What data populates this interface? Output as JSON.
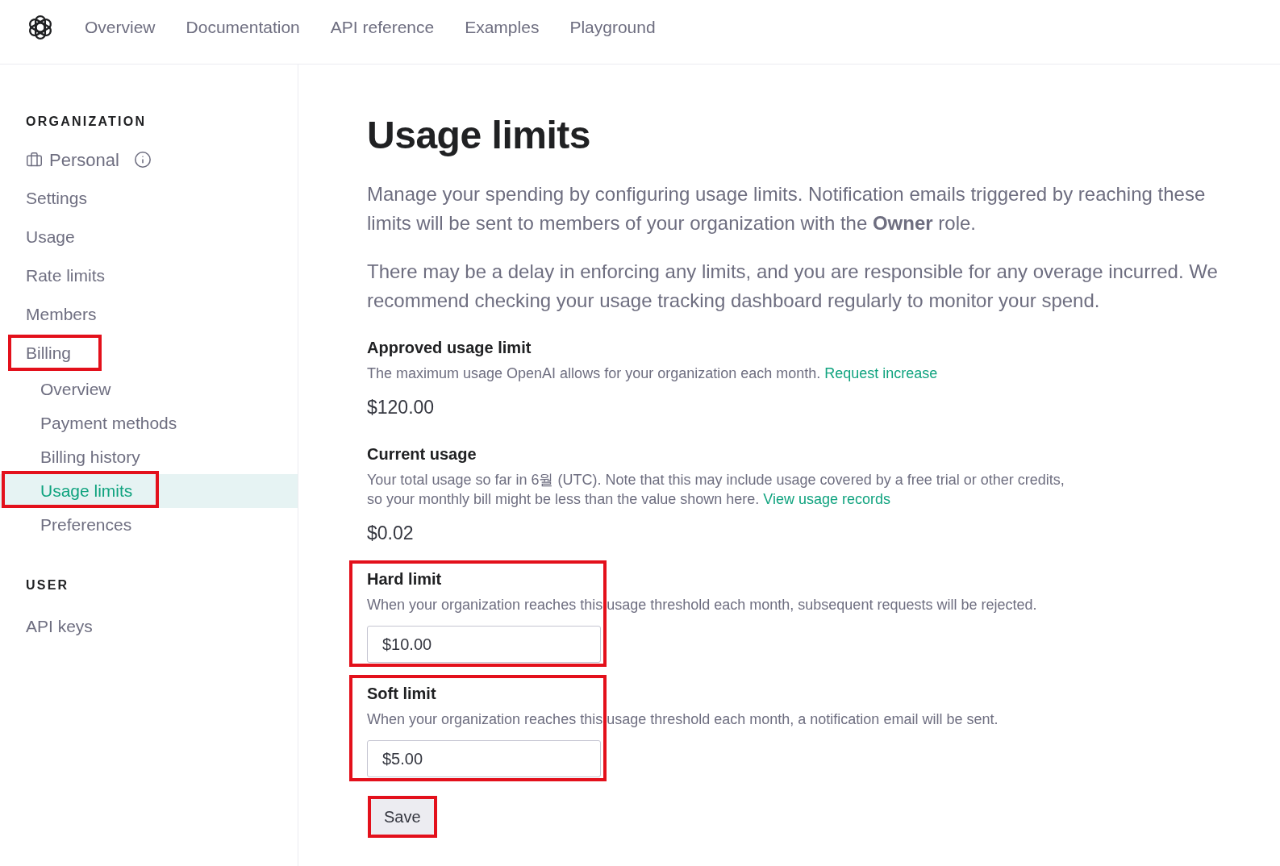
{
  "nav": {
    "items": [
      {
        "label": "Overview"
      },
      {
        "label": "Documentation"
      },
      {
        "label": "API reference"
      },
      {
        "label": "Examples"
      },
      {
        "label": "Playground"
      }
    ]
  },
  "sidebar": {
    "sections": [
      {
        "heading": "ORGANIZATION",
        "items": [
          {
            "label": "Personal",
            "kind": "organization",
            "selected": false,
            "highlighted": false
          },
          {
            "label": "Settings",
            "kind": "link",
            "selected": false,
            "highlighted": false
          },
          {
            "label": "Usage",
            "kind": "link",
            "selected": false,
            "highlighted": false
          },
          {
            "label": "Rate limits",
            "kind": "link",
            "selected": false,
            "highlighted": false
          },
          {
            "label": "Members",
            "kind": "link",
            "selected": false,
            "highlighted": false
          },
          {
            "label": "Billing",
            "kind": "link",
            "selected": false,
            "highlighted": true,
            "children": [
              {
                "label": "Overview",
                "kind": "link",
                "selected": false,
                "highlighted": false
              },
              {
                "label": "Payment methods",
                "kind": "link",
                "selected": false,
                "highlighted": false
              },
              {
                "label": "Billing history",
                "kind": "link",
                "selected": false,
                "highlighted": false
              },
              {
                "label": "Usage limits",
                "kind": "link",
                "selected": true,
                "highlighted": true
              },
              {
                "label": "Preferences",
                "kind": "link",
                "selected": false,
                "highlighted": false
              }
            ]
          }
        ]
      },
      {
        "heading": "USER",
        "items": [
          {
            "label": "API keys",
            "kind": "link",
            "selected": false,
            "highlighted": false
          }
        ]
      }
    ]
  },
  "page": {
    "title": "Usage limits",
    "intro": [
      "Manage your spending by configuring usage limits. Notification emails triggered by reaching these limits will be sent to members of your organization with the **Owner** role.",
      "There may be a delay in enforcing any limits, and you are responsible for any overage incurred. We recommend checking your usage tracking dashboard regularly to monitor your spend."
    ],
    "sections": [
      {
        "kind": "amount",
        "heading": "Approved usage limit",
        "description": "The maximum usage OpenAI allows for your organization each month.",
        "link": "Request increase",
        "value": "$120.00",
        "highlighted": false
      },
      {
        "kind": "amount",
        "heading": "Current usage",
        "description": "Your total usage so far in 6월 (UTC). Note that this may include usage covered by a free trial or other credits, so your monthly bill might be less than the value shown here.",
        "link": "View usage records",
        "value": "$0.02",
        "highlighted": false
      },
      {
        "kind": "input",
        "heading": "Hard limit",
        "description": "When your organization reaches this usage threshold each month, subsequent requests will be rejected.",
        "value": "$10.00",
        "highlighted": true
      },
      {
        "kind": "input",
        "heading": "Soft limit",
        "description": "When your organization reaches this usage threshold each month, a notification email will be sent.",
        "value": "$5.00",
        "highlighted": true
      }
    ],
    "save_button": {
      "label": "Save",
      "highlighted": true
    }
  }
}
